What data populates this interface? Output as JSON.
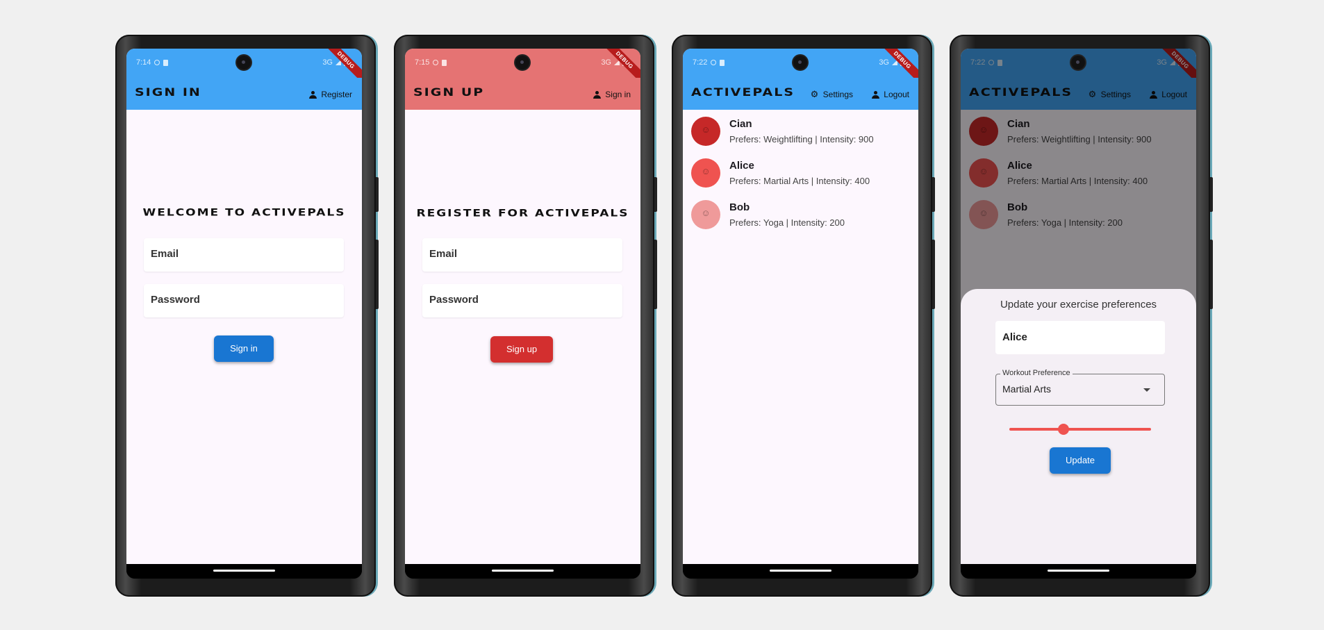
{
  "colors": {
    "blue_appbar": "#42a5f5",
    "red_appbar": "#e57373",
    "primary_button": "#1976d2",
    "signup_button": "#d32f2f",
    "slider": "#ef5350"
  },
  "screens": {
    "signin": {
      "status_time": "7:14",
      "network": "3G",
      "debug": "DEBUG",
      "title": "Sign in",
      "action_label": "Register",
      "heading": "Welcome to ActivePals",
      "email_label": "Email",
      "password_label": "Password",
      "button": "Sign in"
    },
    "signup": {
      "status_time": "7:15",
      "network": "3G",
      "debug": "DEBUG",
      "title": "Sign up",
      "action_label": "Sign in",
      "heading": "Register for ActivePals",
      "email_label": "Email",
      "password_label": "Password",
      "button": "Sign up"
    },
    "home": {
      "status_time": "7:22",
      "network": "3G",
      "debug": "DEBUG",
      "title": "ActivePals",
      "settings_label": "Settings",
      "logout_label": "Logout",
      "users": [
        {
          "name": "Cian",
          "details": "Prefers: Weightlifting | Intensity: 900",
          "color": "#c62828"
        },
        {
          "name": "Alice",
          "details": "Prefers: Martial Arts | Intensity: 400",
          "color": "#ef5350"
        },
        {
          "name": "Bob",
          "details": "Prefers: Yoga | Intensity: 200",
          "color": "#ef9a9a"
        }
      ]
    },
    "update": {
      "status_time": "7:22",
      "network": "3G",
      "debug": "DEBUG",
      "title": "ActivePals",
      "settings_label": "Settings",
      "logout_label": "Logout",
      "users": [
        {
          "name": "Cian",
          "details": "Prefers: Weightlifting | Intensity: 900",
          "color": "#c62828"
        },
        {
          "name": "Alice",
          "details": "Prefers: Martial Arts | Intensity: 400",
          "color": "#ef5350"
        },
        {
          "name": "Bob",
          "details": "Prefers: Yoga | Intensity: 200",
          "color": "#ef9a9a"
        }
      ],
      "sheet_title": "Update your exercise preferences",
      "name_value": "Alice",
      "dropdown_label": "Workout Preference",
      "dropdown_value": "Martial Arts",
      "slider_fraction": 0.38,
      "button": "Update"
    }
  }
}
